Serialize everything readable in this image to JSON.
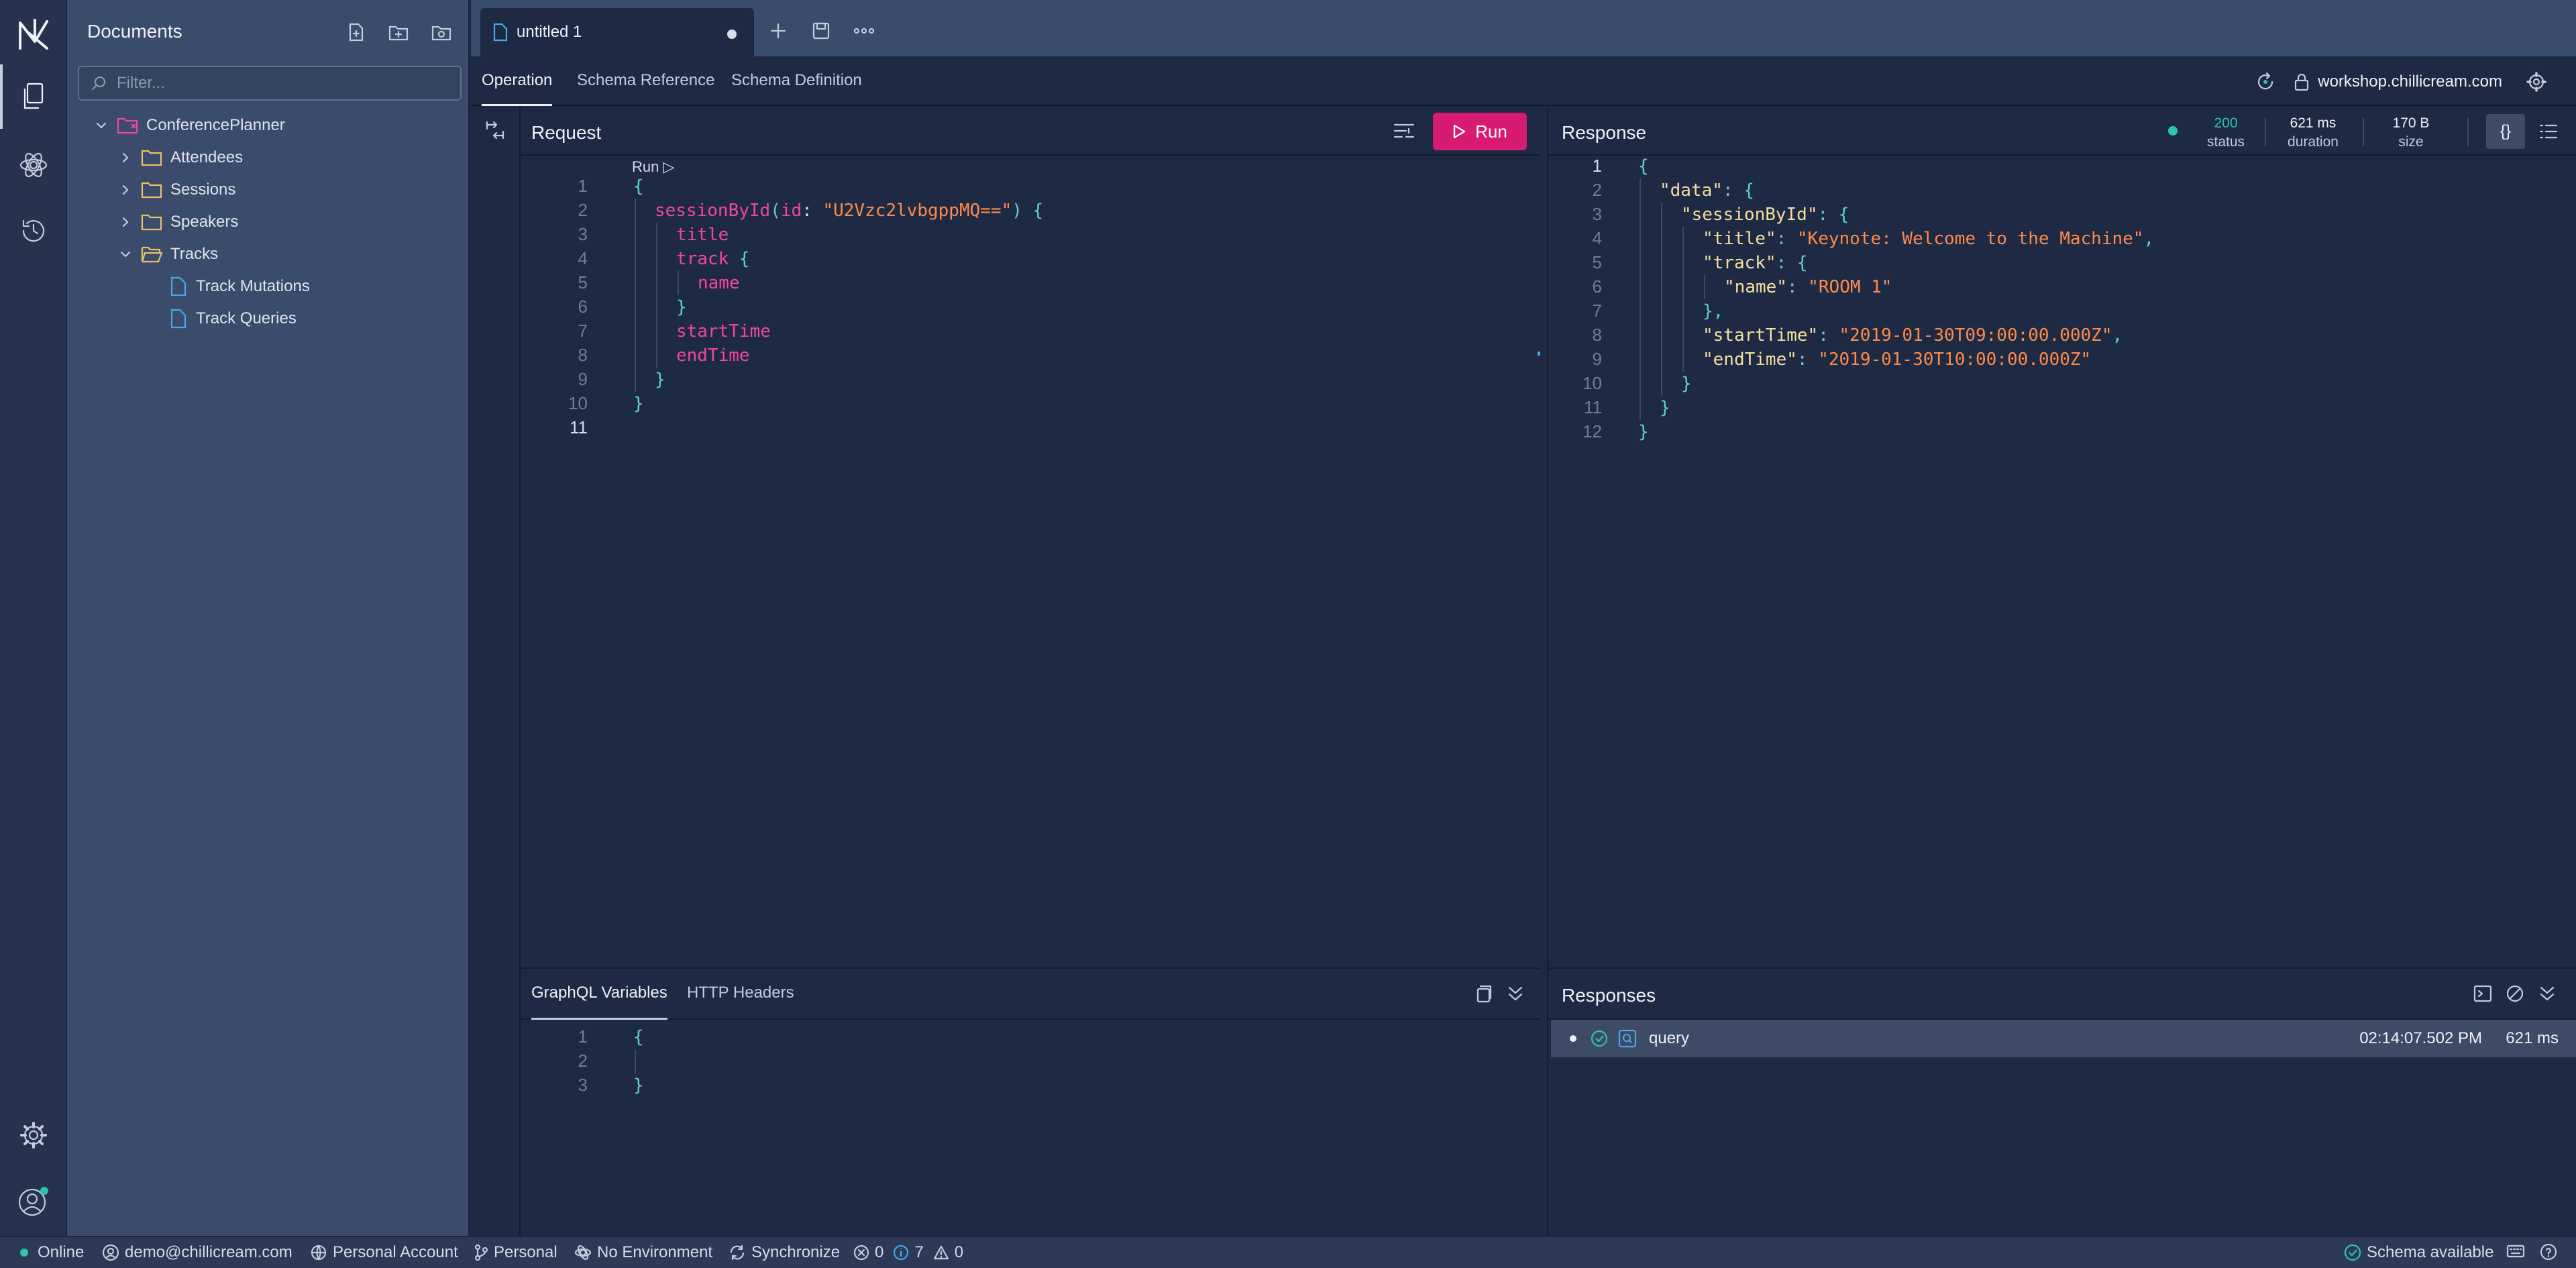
{
  "sidebar": {
    "title": "Documents",
    "filter_placeholder": "Filter...",
    "tree": {
      "root": "ConferencePlanner",
      "folders": [
        "Attendees",
        "Sessions",
        "Speakers",
        "Tracks"
      ],
      "track_docs": [
        "Track Mutations",
        "Track Queries"
      ]
    }
  },
  "tabs": {
    "active": "untitled 1"
  },
  "subnav": {
    "tabs": [
      "Operation",
      "Schema Reference",
      "Schema Definition"
    ],
    "host": "workshop.chillicream.com"
  },
  "request": {
    "title": "Request",
    "run_label": "Run",
    "codelens": "Run ▷",
    "line_numbers": [
      "1",
      "2",
      "3",
      "4",
      "5",
      "6",
      "7",
      "8",
      "9",
      "10",
      "11"
    ],
    "code": {
      "open": "{",
      "field": "sessionById",
      "arg_name": "id",
      "arg_value": "\"U2Vzc2lvbgppMQ==\"",
      "title": "title",
      "track": "track",
      "name": "name",
      "startTime": "startTime",
      "endTime": "endTime",
      "close": "}"
    }
  },
  "response": {
    "title": "Response",
    "status": {
      "value": "200",
      "label": "status"
    },
    "duration": {
      "value": "621 ms",
      "label": "duration"
    },
    "size": {
      "value": "170 B",
      "label": "size"
    },
    "line_numbers": [
      "1",
      "2",
      "3",
      "4",
      "5",
      "6",
      "7",
      "8",
      "9",
      "10",
      "11",
      "12"
    ],
    "json": {
      "data_key": "\"data\"",
      "session_key": "\"sessionById\"",
      "title_key": "\"title\"",
      "title_val": "\"Keynote: Welcome to the Machine\"",
      "track_key": "\"track\"",
      "name_key": "\"name\"",
      "name_val": "\"ROOM 1\"",
      "start_key": "\"startTime\"",
      "start_val": "\"2019-01-30T09:00:00.000Z\"",
      "end_key": "\"endTime\"",
      "end_val": "\"2019-01-30T10:00:00.000Z\""
    }
  },
  "variables": {
    "tabs": [
      "GraphQL Variables",
      "HTTP Headers"
    ],
    "line_numbers": [
      "1",
      "2",
      "3"
    ],
    "open": "{",
    "close": "}"
  },
  "responses": {
    "title": "Responses",
    "item": {
      "name": "query",
      "time": "02:14:07.502 PM",
      "duration": "621 ms"
    }
  },
  "statusbar": {
    "online": "Online",
    "user": "demo@chillicream.com",
    "account": "Personal Account",
    "workspace": "Personal",
    "environment": "No Environment",
    "sync": "Synchronize",
    "errors": "0",
    "infos": "7",
    "warnings": "0",
    "schema": "Schema available"
  },
  "colors": {
    "accent": "#d81b72",
    "success": "#2ec4a6",
    "string": "#ff8a4b",
    "keyword": "#f0479c",
    "punct": "#5fd3c7"
  }
}
